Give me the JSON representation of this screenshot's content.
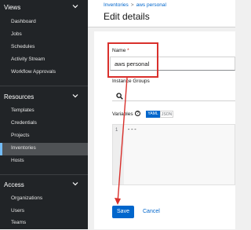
{
  "sidebar": {
    "sections": [
      {
        "title": "Views",
        "items": [
          "Dashboard",
          "Jobs",
          "Schedules",
          "Activity Stream",
          "Workflow Approvals"
        ]
      },
      {
        "title": "Resources",
        "items": [
          "Templates",
          "Credentials",
          "Projects",
          "Inventories",
          "Hosts"
        ]
      },
      {
        "title": "Access",
        "items": [
          "Organizations",
          "Users",
          "Teams"
        ]
      }
    ],
    "active_item": "Inventories"
  },
  "header": {
    "breadcrumb": {
      "root": "Inventories",
      "current": "aws personal"
    },
    "title": "Edit details"
  },
  "form": {
    "name_label": "Name",
    "required_marker": "*",
    "name_value": "aws personal",
    "instance_groups_label": "Instance Groups",
    "variables_label": "Variables",
    "help_glyph": "?",
    "toggle": {
      "yaml": "YAML",
      "json": "JSON",
      "selected": "YAML"
    },
    "editor": {
      "line_number": "1",
      "content": "---"
    },
    "save_label": "Save",
    "cancel_label": "Cancel"
  },
  "colors": {
    "sidebar_bg": "#212427",
    "primary": "#0066cc",
    "annotation": "#d9302c"
  }
}
